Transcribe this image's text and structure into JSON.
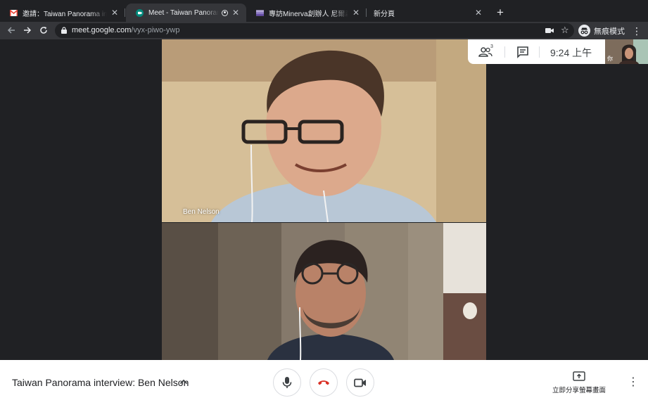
{
  "browser": {
    "tabs": [
      {
        "title": "邀請：Taiwan Panorama interview",
        "icon": "gmail-icon"
      },
      {
        "title": "Meet - Taiwan Panorama in",
        "icon": "meet-icon"
      },
      {
        "title": "專訪Minerva創辦人 尼爾森一名",
        "icon": "flag-icon"
      },
      {
        "title": "新分頁",
        "icon": ""
      }
    ],
    "url_host": "meet.google.com",
    "url_path": "/vyx-piwo-ywp",
    "incognito_label": "無痕模式"
  },
  "meet": {
    "participant_count": "3",
    "clock": "9:24  上午",
    "self_label": "你",
    "participants": [
      {
        "name": "Ben Nelson"
      }
    ],
    "meeting_title": "Taiwan Panorama interview: Ben Nelson",
    "present_label": "立即分享螢幕畫面"
  },
  "colors": {
    "tab_bg": "#202124",
    "toolbar_bg": "#35363a",
    "end_call_red": "#d93025",
    "bottombar_bg": "#ffffff"
  }
}
